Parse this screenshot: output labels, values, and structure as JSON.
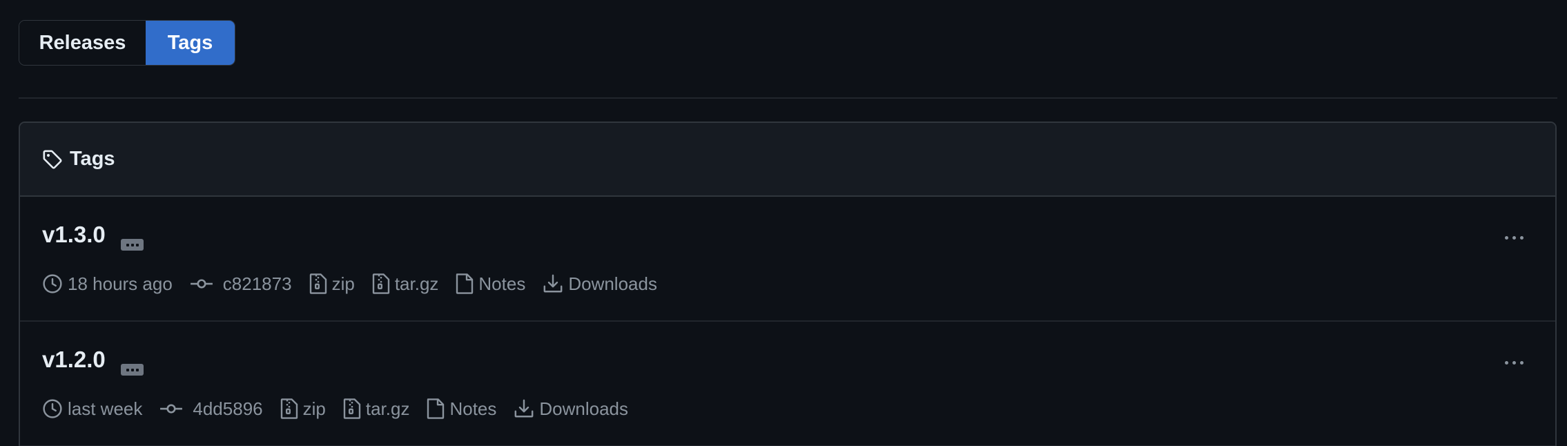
{
  "nav": {
    "releases_label": "Releases",
    "tags_label": "Tags"
  },
  "box": {
    "title": "Tags"
  },
  "tags": [
    {
      "name": "v1.3.0",
      "time": "18 hours ago",
      "commit": "c821873",
      "zip": "zip",
      "targz": "tar.gz",
      "notes": "Notes",
      "downloads": "Downloads"
    },
    {
      "name": "v1.2.0",
      "time": "last week",
      "commit": "4dd5896",
      "zip": "zip",
      "targz": "tar.gz",
      "notes": "Notes",
      "downloads": "Downloads"
    }
  ],
  "colors": {
    "background": "#0d1117",
    "accent": "#316dca",
    "header_bg": "#161b22",
    "border": "#30363d",
    "muted_text": "#8b949e"
  },
  "icons": {
    "header": "tag-icon",
    "time": "clock-icon",
    "commit": "git-commit-icon",
    "archive": "file-zip-icon",
    "notes": "file-icon",
    "downloads": "download-icon",
    "menu": "kebab-horizontal-icon"
  }
}
